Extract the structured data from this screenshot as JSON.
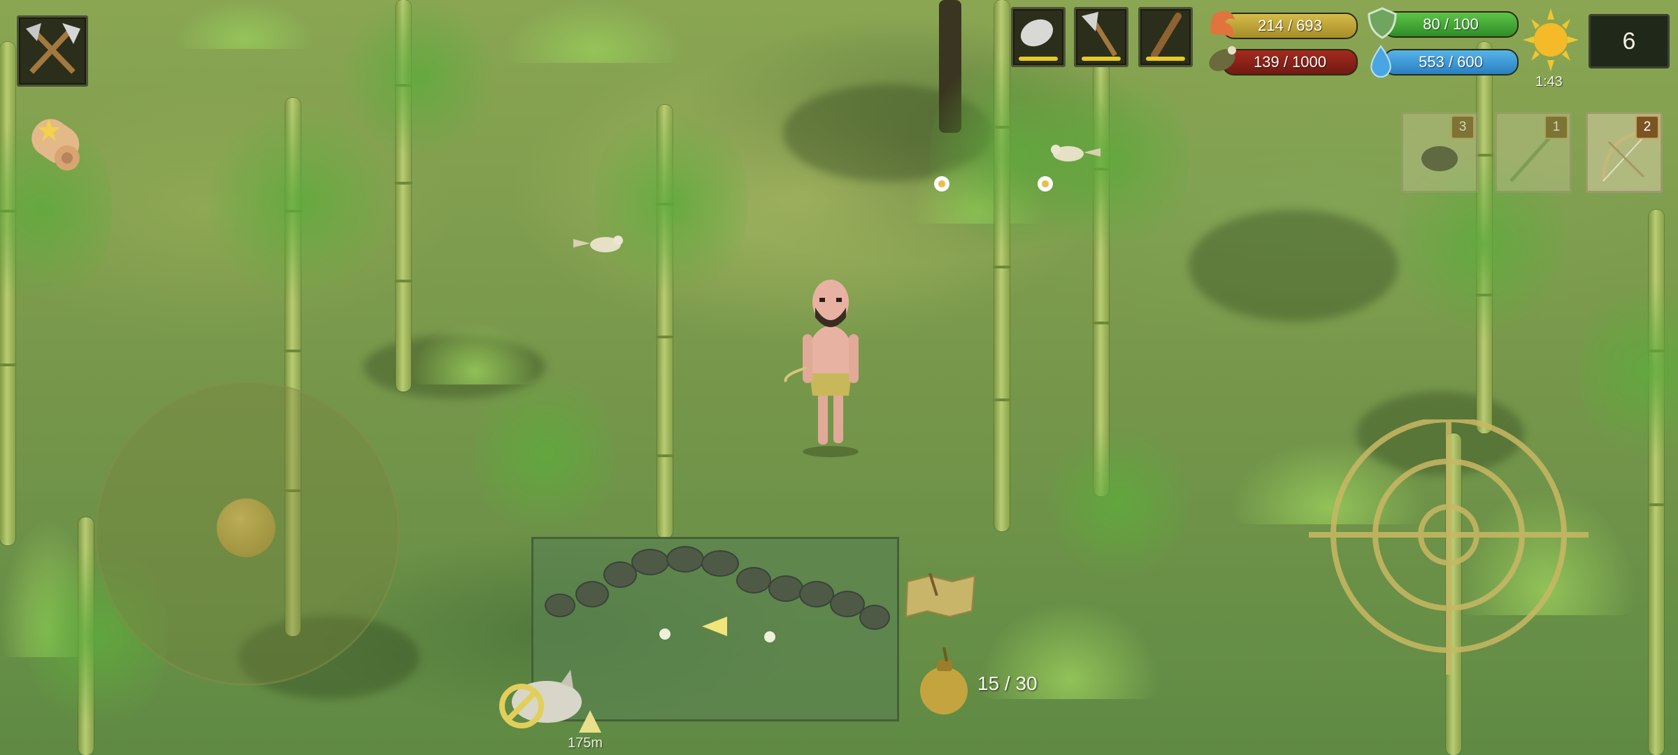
{
  "hud": {
    "equipment_slots": [
      {
        "icon": "stone-icon"
      },
      {
        "icon": "stone-axe-icon"
      },
      {
        "icon": "wooden-club-icon"
      }
    ],
    "stats": {
      "strength": {
        "icon": "flexed-arm-icon",
        "text": "214 / 693",
        "color": "#c1a73a"
      },
      "armor": {
        "icon": "shield-icon",
        "text": "80 / 100",
        "color": "#4fb33d"
      },
      "food": {
        "icon": "meat-icon",
        "text": "139 / 1000",
        "color": "#8b1c14"
      },
      "water": {
        "icon": "water-drop-icon",
        "text": "553 / 600",
        "color": "#3a9ad6"
      }
    },
    "time": "1:43",
    "day_icon": "sun-icon",
    "level": "6"
  },
  "left_buttons": {
    "crafting": {
      "icon": "crossed-tools-icon"
    },
    "quests": {
      "icon": "scroll-icon"
    }
  },
  "quick_slots": [
    {
      "icon": "stone-icon",
      "count": "3"
    },
    {
      "icon": "stick-icon",
      "count": "1"
    },
    {
      "icon": "bow-icon",
      "count": "2"
    }
  ],
  "bottom": {
    "bag_count": "15 / 30",
    "bag_icon": "pouch-icon",
    "map_icon": "treasure-map-icon",
    "wolf_icon": "wolf-no-icon",
    "distance": "175m",
    "tree_icon": "tree-marker-icon"
  }
}
